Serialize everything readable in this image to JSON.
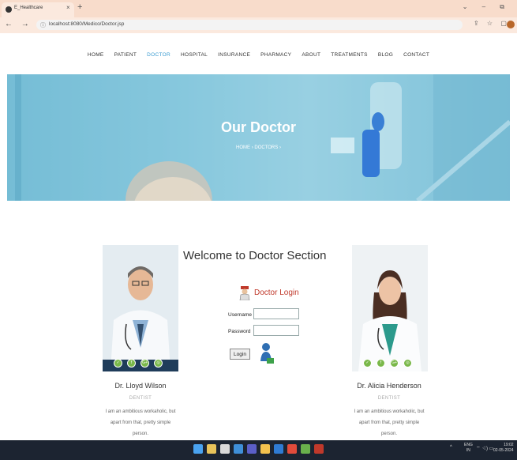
{
  "browser": {
    "tab_title": "E_Healthcare",
    "new_tab": "+",
    "url": "localhost:8080/Medico/Doctor.jsp",
    "window_controls": "⌄ – ⧉",
    "nav_icons": "← → C",
    "right_icons": "⇪ ☆ ▢"
  },
  "nav": {
    "items": [
      "HOME",
      "PATIENT",
      "DOCTOR",
      "HOSPITAL",
      "INSURANCE",
      "PHARMACY",
      "ABOUT",
      "TREATMENTS",
      "BLOG",
      "CONTACT"
    ],
    "active": "DOCTOR"
  },
  "hero": {
    "title": "Our Doctor",
    "breadcrumb": "HOME ›  DOCTORS ›"
  },
  "welcome": "Welcome to Doctor Section",
  "login": {
    "title": "Doctor Login",
    "username_label": "Username",
    "password_label": "Password",
    "username_value": "",
    "password_value": "",
    "button": "Login"
  },
  "doctors": [
    {
      "name": "Dr. Lloyd Wilson",
      "role": "DENTIST",
      "desc_line1": "I am an ambitious workaholic, but",
      "desc_line2": "apart from that, pretty simple",
      "desc_line3": "person."
    },
    {
      "name": "Dr. Alicia Henderson",
      "role": "DENTIST",
      "desc_line1": "I am an ambitious workaholic, but",
      "desc_line2": "apart from that, pretty simple",
      "desc_line3": "person."
    }
  ],
  "social_icons": [
    "✓",
    "f",
    "G+",
    "◎"
  ],
  "taskbar": {
    "tray": "^",
    "lang_line1": "ENG",
    "lang_line2": "IN",
    "wifi": "⌔ ◁) ▭",
    "time": "19:02",
    "date": "02-05-2024"
  },
  "colors": {
    "accent": "#3a9bd1",
    "login_title": "#c0392b",
    "social": "#7ab84a",
    "hero": "#8ccbe0",
    "taskbar": "#1c2431"
  }
}
